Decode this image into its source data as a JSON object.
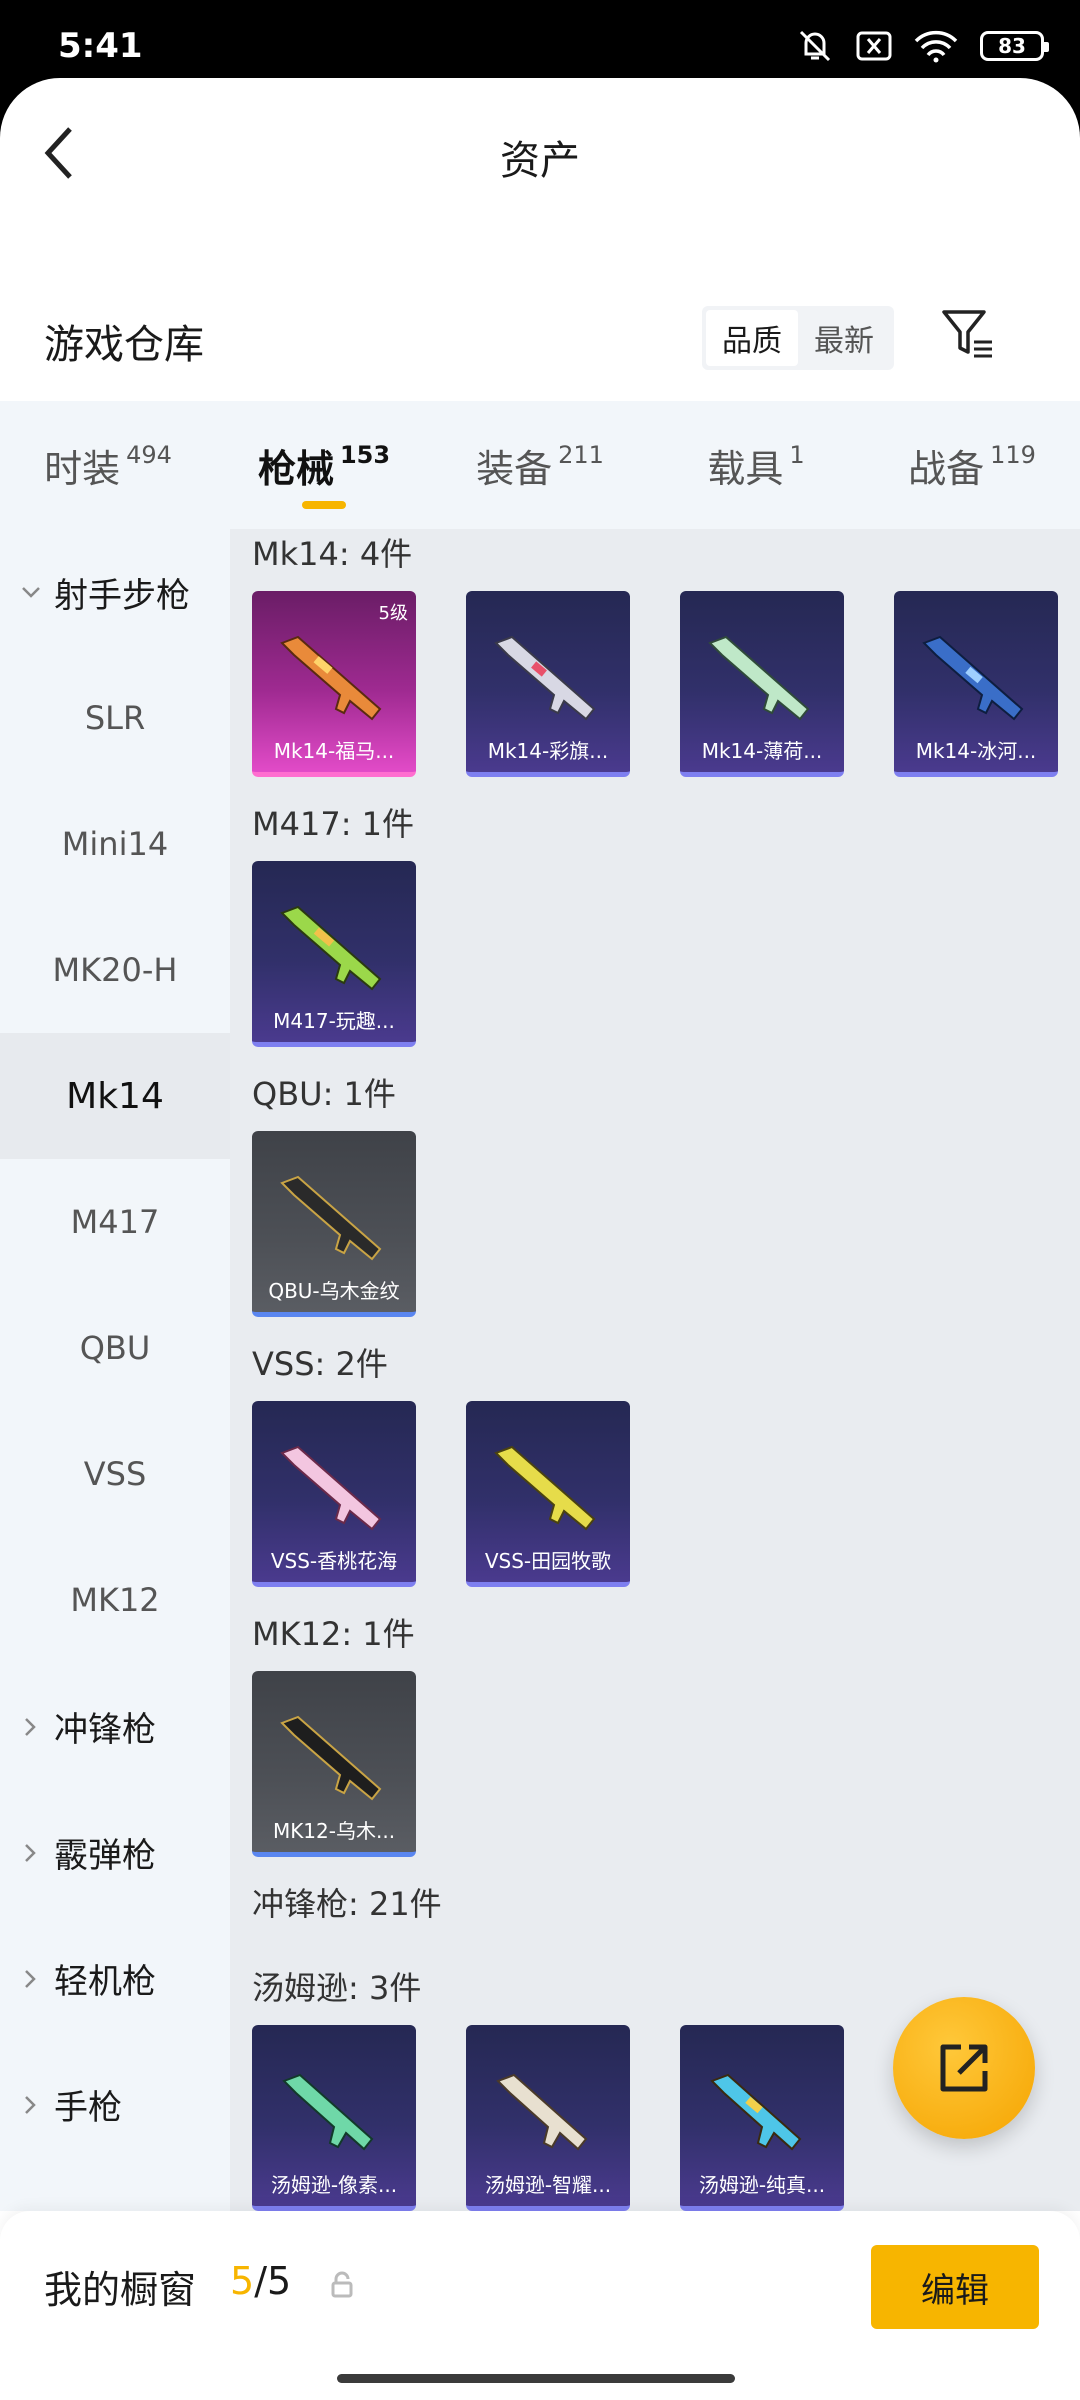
{
  "status_bar": {
    "time": "5:41",
    "battery": "83"
  },
  "header": {
    "title": "资产"
  },
  "section": {
    "title": "游戏仓库",
    "sort_options": [
      "品质",
      "最新"
    ]
  },
  "tabs": [
    {
      "label": "时装",
      "count": "494"
    },
    {
      "label": "枪械",
      "count": "153"
    },
    {
      "label": "装备",
      "count": "211"
    },
    {
      "label": "载具",
      "count": "1"
    },
    {
      "label": "战备",
      "count": "119"
    }
  ],
  "sidebar": {
    "items": [
      {
        "label": "射手步枪"
      },
      {
        "label": "SLR"
      },
      {
        "label": "Mini14"
      },
      {
        "label": "MK20-H"
      },
      {
        "label": "Mk14"
      },
      {
        "label": "M417"
      },
      {
        "label": "QBU"
      },
      {
        "label": "VSS"
      },
      {
        "label": "MK12"
      },
      {
        "label": "冲锋枪"
      },
      {
        "label": "霰弹枪"
      },
      {
        "label": "轻机枪"
      },
      {
        "label": "手枪"
      }
    ]
  },
  "groups": [
    {
      "label": "Mk14: 4件",
      "items": [
        {
          "name": "Mk14-福马...",
          "level": "5级"
        },
        {
          "name": "Mk14-彩旗..."
        },
        {
          "name": "Mk14-薄荷..."
        },
        {
          "name": "Mk14-冰河..."
        }
      ]
    },
    {
      "label": "M417: 1件",
      "items": [
        {
          "name": "M417-玩趣..."
        }
      ]
    },
    {
      "label": "QBU: 1件",
      "items": [
        {
          "name": "QBU-乌木金纹"
        }
      ]
    },
    {
      "label": "VSS: 2件",
      "items": [
        {
          "name": "VSS-香桃花海"
        },
        {
          "name": "VSS-田园牧歌"
        }
      ]
    },
    {
      "label": "MK12: 1件",
      "items": [
        {
          "name": "MK12-乌木..."
        }
      ]
    },
    {
      "label": "冲锋枪: 21件",
      "items": []
    },
    {
      "label": "汤姆逊: 3件",
      "items": [
        {
          "name": "汤姆逊-像素..."
        },
        {
          "name": "汤姆逊-智耀..."
        },
        {
          "name": "汤姆逊-纯真..."
        }
      ]
    }
  ],
  "bottom_bar": {
    "title": "我的橱窗",
    "current": "5",
    "separator": "/",
    "total": "5",
    "edit_label": "编辑"
  }
}
